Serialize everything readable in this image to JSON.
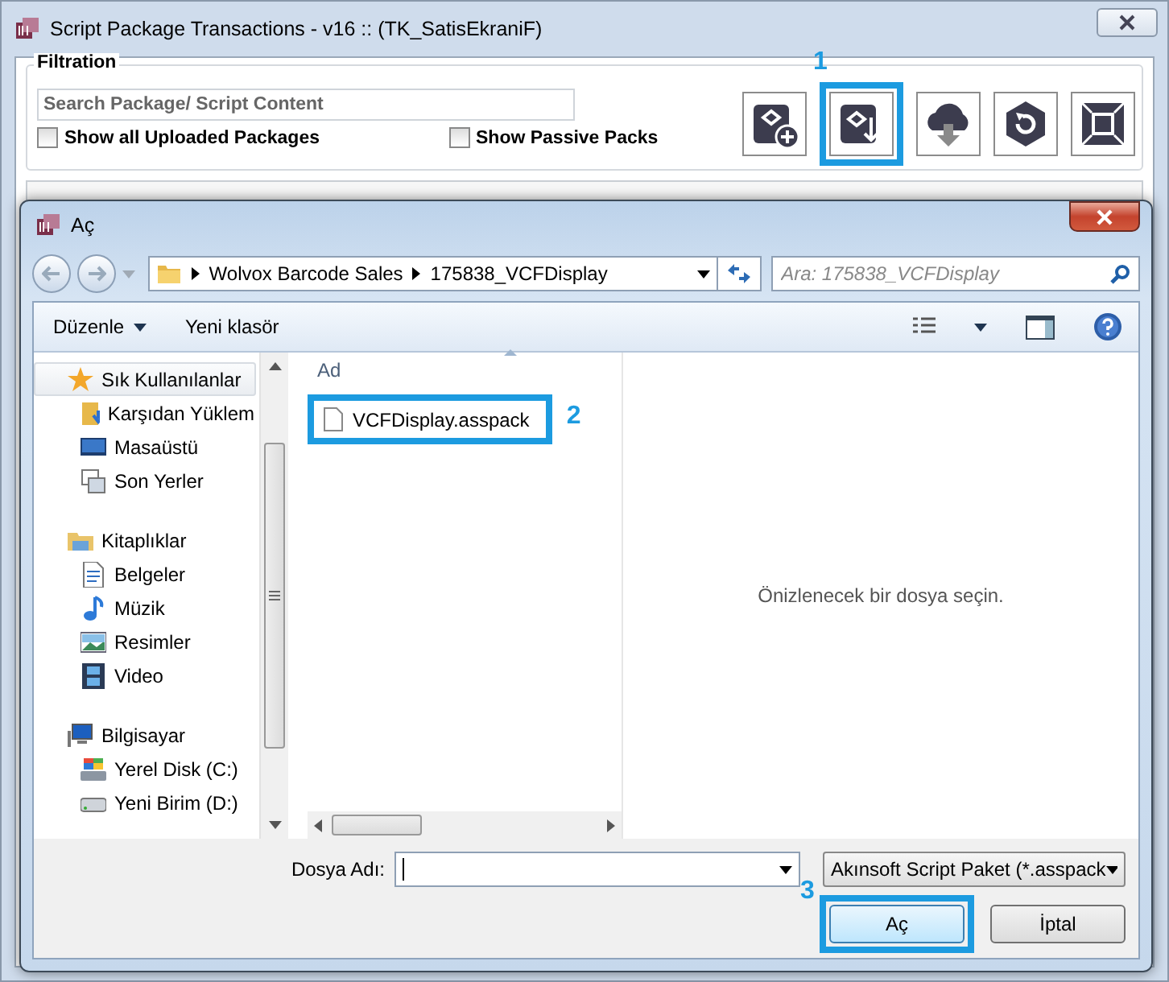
{
  "window": {
    "title": "Script Package Transactions - v16 :: (TK_SatisEkraniF)"
  },
  "filtration": {
    "title": "Filtration",
    "search": {
      "placeholder": "Search Package/ Script Content"
    },
    "options": [
      {
        "label": "Show all Uploaded Packages",
        "checked": false
      },
      {
        "label": "Show Passive Packs",
        "checked": false
      }
    ]
  },
  "tool_buttons": [
    {
      "kind": "add"
    },
    {
      "kind": "import",
      "callout": "1"
    },
    {
      "kind": "cloud"
    },
    {
      "kind": "refresh"
    },
    {
      "kind": "maximize"
    }
  ],
  "dialog": {
    "title": "Aç",
    "path": [
      "Wolvox Barcode Sales",
      "175838_VCFDisplay"
    ],
    "search": {
      "placeholder": "Ara: 175838_VCFDisplay"
    },
    "toolbar": [
      {
        "label": "Düzenle",
        "kind": "menu"
      },
      {
        "label": "Yeni klasör",
        "kind": "button"
      }
    ],
    "nav": [
      {
        "label": "Sık Kullanılanlar",
        "kind": "star",
        "selected": true,
        "children": [
          {
            "label": "Karşıdan Yüklem",
            "kind": "download",
            "selected": false
          },
          {
            "label": "Masaüstü",
            "kind": "desktop",
            "selected": false
          },
          {
            "label": "Son Yerler",
            "kind": "recent",
            "selected": false
          }
        ]
      },
      {
        "label": "Kitaplıklar",
        "kind": "library",
        "selected": false,
        "children": [
          {
            "label": "Belgeler",
            "kind": "documents",
            "selected": false
          },
          {
            "label": "Müzik",
            "kind": "music",
            "selected": false
          },
          {
            "label": "Resimler",
            "kind": "pictures",
            "selected": false
          },
          {
            "label": "Video",
            "kind": "video",
            "selected": false
          }
        ]
      },
      {
        "label": "Bilgisayar",
        "kind": "computer",
        "selected": false,
        "children": [
          {
            "label": "Yerel Disk (C:)",
            "kind": "disk",
            "selected": false
          },
          {
            "label": "Yeni Birim (D:)",
            "kind": "drive",
            "selected": false
          }
        ]
      }
    ],
    "column": "Ad",
    "files": [
      {
        "name": "VCFDisplay.asspack",
        "callout": "2"
      }
    ],
    "preview_hint": "Önizlenecek bir dosya seçin.",
    "file_name_label": "Dosya Adı:",
    "filter": "Akınsoft Script Paket (*.asspack",
    "buttons": [
      {
        "label": "Aç",
        "kind": "default",
        "callout": "3"
      },
      {
        "label": "İptal",
        "kind": "normal"
      }
    ]
  }
}
